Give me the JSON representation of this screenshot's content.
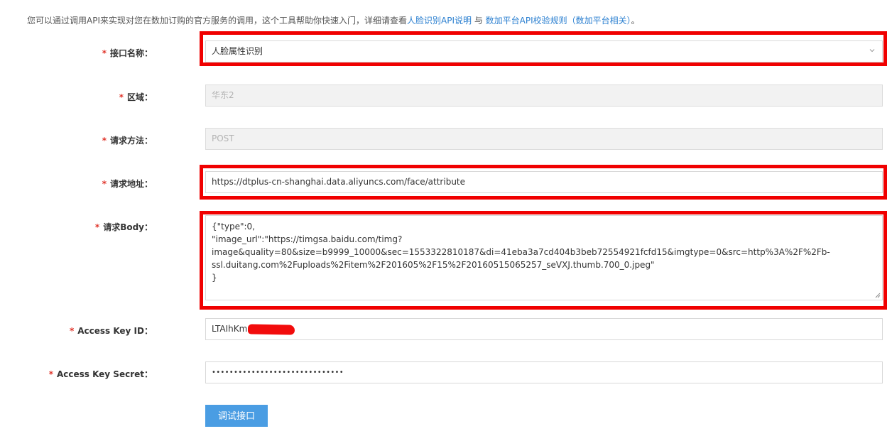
{
  "intro": {
    "text": "您可以通过调用API来实现对您在数加订购的官方服务的调用，这个工具帮助你快速入门，详细请查看",
    "link1": "人脸识别API说明",
    "and": " 与 ",
    "link2": "数加平台API校验规则（数加平台相关）",
    "end": "。"
  },
  "form": {
    "required_mark": "*",
    "interface": {
      "label": "接口名称：",
      "value": "人脸属性识别"
    },
    "region": {
      "label": "区域：",
      "value": "华东2"
    },
    "method": {
      "label": "请求方法：",
      "value": "POST"
    },
    "url": {
      "label": "请求地址：",
      "value": "https://dtplus-cn-shanghai.data.aliyuncs.com/face/attribute"
    },
    "body": {
      "label": "请求Body：",
      "lines": [
        "{\"type\":0,",
        "\"image_url\":\"https://timgsa.baidu.com/timg?",
        "image&quality=80&size=b9999_10000&sec=1553322810187&di=41eba3a7cd404b3beb72554921fcfd15&imgtype=0&src=http%3A%2F%2Fb-",
        "ssl.duitang.com%2Fuploads%2Fitem%2F201605%2F15%2F20160515065257_seVXJ.thumb.700_0.jpeg\"",
        "}"
      ]
    },
    "access_key_id": {
      "label": "Access Key ID：",
      "value": "LTAIhKmn"
    },
    "access_key_secret": {
      "label": "Access Key Secret：",
      "value": "••••••••••••••••••••••••••••••"
    },
    "submit_label": "调试接口"
  },
  "colors": {
    "highlight": "#f00000",
    "required": "#e0342a",
    "link": "#2a7fd0",
    "button": "#4a9de3"
  },
  "icons": {
    "select_arrow": "chevron-down-icon",
    "textarea_resize": "resize-grip-icon"
  }
}
